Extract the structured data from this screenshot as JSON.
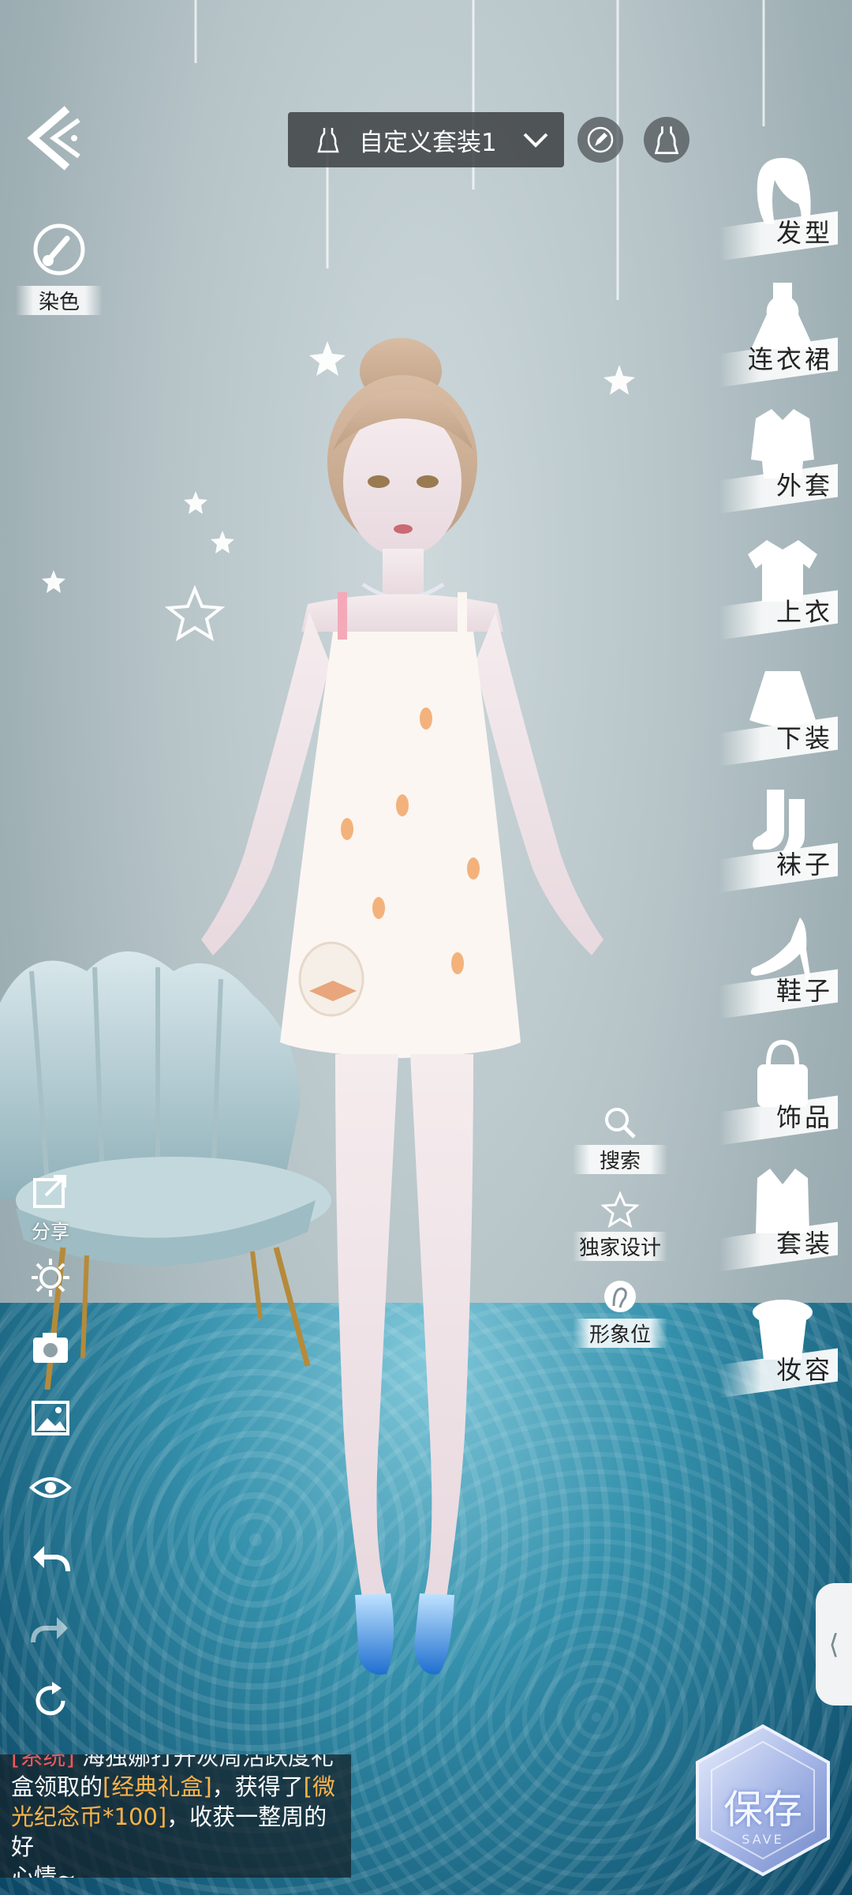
{
  "header": {
    "outfit_name": "自定义套装1"
  },
  "left_tools": {
    "dye_label": "染色",
    "share_label": "分享"
  },
  "categories": [
    {
      "key": "hair",
      "label": "发型",
      "icon": "hair-icon"
    },
    {
      "key": "dress",
      "label": "连衣裙",
      "icon": "dress-icon"
    },
    {
      "key": "coat",
      "label": "外套",
      "icon": "coat-icon"
    },
    {
      "key": "top",
      "label": "上衣",
      "icon": "top-icon"
    },
    {
      "key": "bottom",
      "label": "下装",
      "icon": "skirt-icon"
    },
    {
      "key": "socks",
      "label": "袜子",
      "icon": "socks-icon"
    },
    {
      "key": "shoes",
      "label": "鞋子",
      "icon": "heel-icon"
    },
    {
      "key": "accessory",
      "label": "饰品",
      "icon": "bag-icon"
    },
    {
      "key": "suit",
      "label": "套装",
      "icon": "suit-icon"
    },
    {
      "key": "makeup",
      "label": "妆容",
      "icon": "makeup-icon"
    }
  ],
  "mid_tools": {
    "search_label": "搜索",
    "exclusive_label": "独家设计",
    "image_label": "形象位"
  },
  "chat": {
    "line1_prefix": "[系统]",
    "line1_rest": "海独娜打开灰周活跃度礼",
    "line2_a": "盒领取的",
    "line2_hl": "[经典礼盒]",
    "line2_b": "，获得了",
    "line2_hl2": "[微",
    "line3_hl": "光纪念币*100]",
    "line3_b": "，收获一整周的好",
    "line4": "心情~"
  },
  "save": {
    "label": "保存",
    "sub": "SAVE"
  },
  "colors": {
    "system_tag": "#ff5a5a",
    "highlight": "#ffb347",
    "accent_water": "#1e8fb0"
  }
}
